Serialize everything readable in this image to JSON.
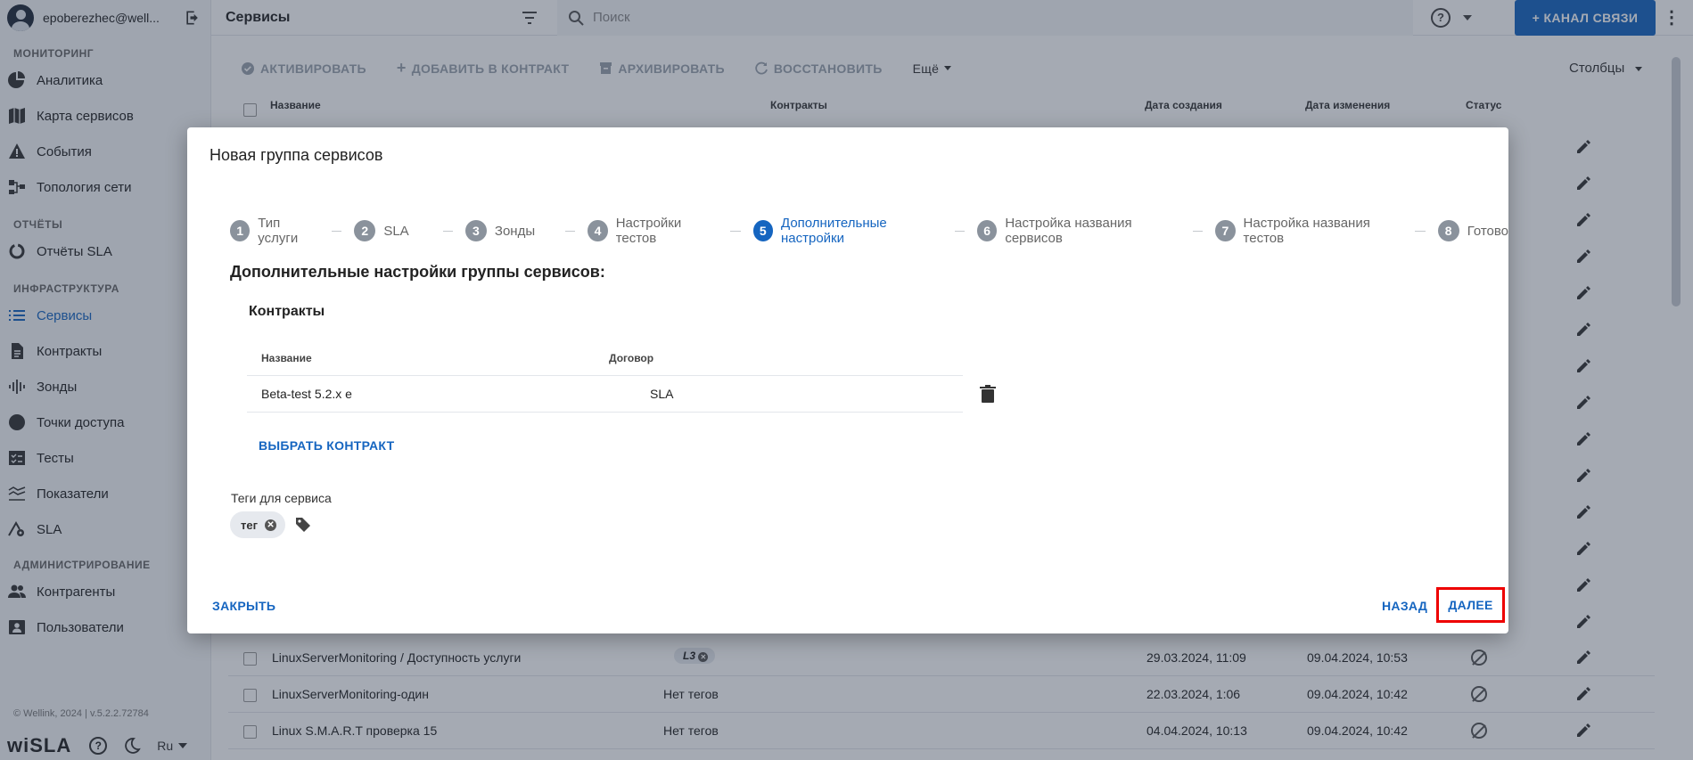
{
  "sidebar": {
    "user": "epoberezhec@well...",
    "sections": {
      "monitoring": "МОНИТОРИНГ",
      "reports": "ОТЧЁТЫ",
      "infra": "ИНФРАСТРУКТУРА",
      "admin": "АДМИНИСТРИРОВАНИЕ"
    },
    "items": {
      "analytics": "Аналитика",
      "service_map": "Карта сервисов",
      "events": "События",
      "topology": "Топология сети",
      "sla_reports": "Отчёты SLA",
      "services": "Сервисы",
      "contracts": "Контракты",
      "probes": "Зонды",
      "access_points": "Точки доступа",
      "tests": "Тесты",
      "indicators": "Показатели",
      "sla": "SLA",
      "counterparties": "Контрагенты",
      "users": "Пользователи"
    },
    "copyright": "© Wellink, 2024 | v.5.2.2.72784",
    "logo": "wiSLA",
    "lang": "Ru"
  },
  "topbar": {
    "title": "Сервисы",
    "search_placeholder": "Поиск",
    "channel_button": "+ КАНАЛ СВЯЗИ"
  },
  "toolbar": {
    "activate": "АКТИВИРОВАТЬ",
    "add_to_contract": "ДОБАВИТЬ В КОНТРАКТ",
    "archive": "АРХИВИРОВАТЬ",
    "restore": "ВОССТАНОВИТЬ",
    "more": "Ещё",
    "columns": "Столбцы"
  },
  "table": {
    "headers": {
      "name": "Название",
      "contracts": "Контракты",
      "created": "Дата создания",
      "changed": "Дата изменения",
      "status": "Статус"
    },
    "rows": [
      {
        "name": "LinuxServerMonitoring / Доступность услуги",
        "tag": "L3",
        "created": "29.03.2024, 11:09",
        "changed": "09.04.2024, 10:53"
      },
      {
        "name": "LinuxServerMonitoring-один",
        "tag": "Нет тегов",
        "created": "22.03.2024, 1:06",
        "changed": "09.04.2024, 10:42"
      },
      {
        "name": "Linux S.M.A.R.T проверка 15",
        "tag": "Нет тегов",
        "created": "04.04.2024, 10:13",
        "changed": "09.04.2024, 10:42"
      }
    ]
  },
  "modal": {
    "title": "Новая группа сервисов",
    "steps": [
      {
        "num": "1",
        "label": "Тип услуги"
      },
      {
        "num": "2",
        "label": "SLA"
      },
      {
        "num": "3",
        "label": "Зонды"
      },
      {
        "num": "4",
        "label": "Настройки тестов"
      },
      {
        "num": "5",
        "label": "Дополнительные настройки"
      },
      {
        "num": "6",
        "label": "Настройка названия сервисов"
      },
      {
        "num": "7",
        "label": "Настройка названия тестов"
      },
      {
        "num": "8",
        "label": "Готово"
      }
    ],
    "section_title": "Дополнительные настройки группы сервисов:",
    "contracts_title": "Контракты",
    "contracts_table": {
      "col_name": "Название",
      "col_agreement": "Договор",
      "rows": [
        {
          "name": "Beta-test 5.2.x e",
          "agreement": "SLA"
        }
      ]
    },
    "select_contract": "ВЫБРАТЬ КОНТРАКТ",
    "tags_label": "Теги для сервиса",
    "tag": "тег",
    "close": "ЗАКРЫТЬ",
    "back": "НАЗАД",
    "next": "ДАЛЕЕ"
  },
  "colors": {
    "accent": "#1565c0",
    "highlight": "#e00000"
  }
}
